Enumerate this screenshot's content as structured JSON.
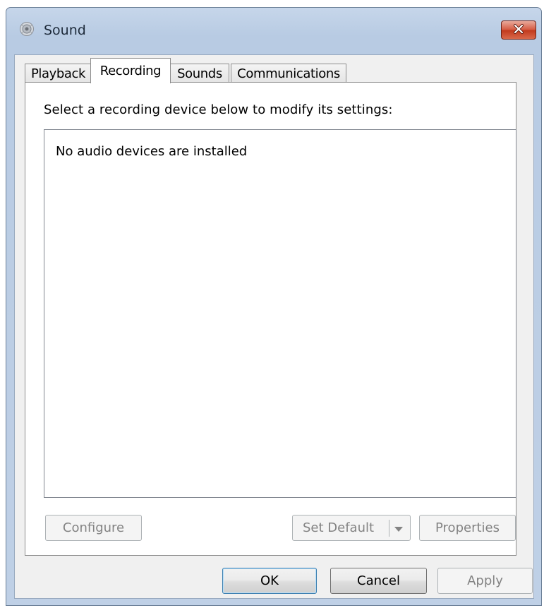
{
  "window": {
    "title": "Sound",
    "icon": "speaker-icon",
    "close_icon": "close-icon"
  },
  "tabs": [
    {
      "label": "Playback",
      "active": false
    },
    {
      "label": "Recording",
      "active": true
    },
    {
      "label": "Sounds",
      "active": false
    },
    {
      "label": "Communications",
      "active": false
    }
  ],
  "recording": {
    "instruction": "Select a recording device below to modify its settings:",
    "empty_message": "No audio devices are installed",
    "configure_label": "Configure",
    "set_default_label": "Set Default",
    "properties_label": "Properties"
  },
  "footer": {
    "ok_label": "OK",
    "cancel_label": "Cancel",
    "apply_label": "Apply"
  },
  "colors": {
    "close_button": "#c1391d",
    "default_button_border": "#3c7fb1",
    "disabled_text": "#838383"
  }
}
